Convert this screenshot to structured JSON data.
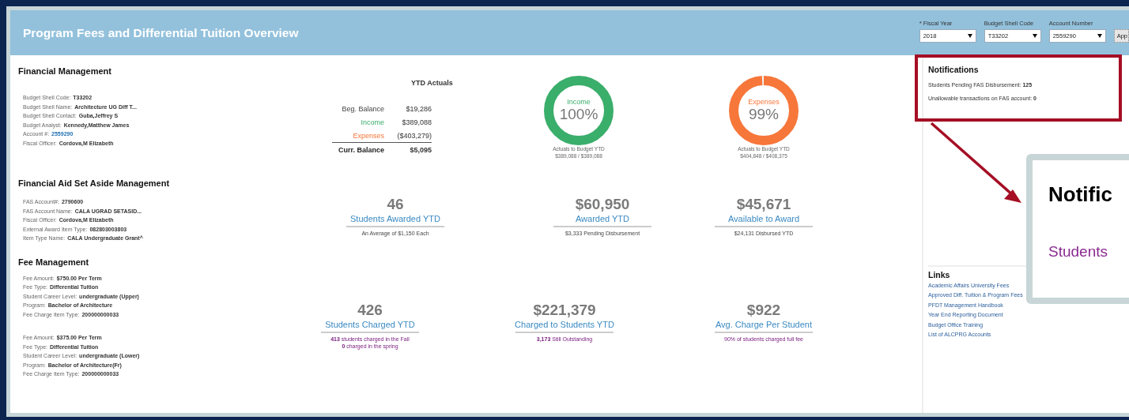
{
  "header": {
    "title": "Program Fees and Differential Tuition Overview",
    "filters": [
      {
        "label": "* Fiscal Year",
        "value": "2018"
      },
      {
        "label": "Budget Shell Code",
        "value": "T33202"
      },
      {
        "label": "Account Number",
        "value": "2559290"
      }
    ],
    "apply_button": "App"
  },
  "financial_management": {
    "title": "Financial Management",
    "details": [
      {
        "label": "Budget Shell Code:",
        "value": "T33202"
      },
      {
        "label": "Budget Shell Name:",
        "value": "Architecture UG Diff T..."
      },
      {
        "label": "Budget Shell Contact:",
        "value": "Guba,Jeffrey S"
      },
      {
        "label": "Budget Analyst:",
        "value": "Kennedy,Matthew James"
      },
      {
        "label": "Account #:",
        "value": "2559290",
        "kind": "link"
      },
      {
        "label": "Fiscal Officer:",
        "value": "Cordova,M Elizabeth"
      }
    ],
    "ytd_actuals": {
      "title": "YTD Actuals",
      "rows": [
        {
          "label": "Beg. Balance",
          "value": "$19,286",
          "kind": "plain"
        },
        {
          "label": "Income",
          "value": "$389,088",
          "kind": "income"
        },
        {
          "label": "Expenses",
          "value": "($403,279)",
          "kind": "expense"
        },
        {
          "label": "Curr. Balance",
          "value": "$5,095",
          "kind": "total"
        }
      ]
    },
    "donuts": [
      {
        "label": "Income",
        "percent": "100%",
        "level": 1,
        "color": "#3aae6b",
        "caption": [
          "Actuals to Budget YTD",
          "$389,088 / $389,088"
        ]
      },
      {
        "label": "Expenses",
        "percent": "99%",
        "level": 0.99,
        "color": "#f7773a",
        "caption": [
          "Actuals to Budget YTD",
          "$404,848 / $408,375"
        ]
      }
    ]
  },
  "fas_management": {
    "title": "Financial Aid Set Aside Management",
    "details": [
      {
        "label": "FAS Account#:",
        "value": "2790600"
      },
      {
        "label": "FAS Account Name:",
        "value": "CALA UGRAD SETASID..."
      },
      {
        "label": "Fiscal Officer:",
        "value": "Cordova,M Elizabeth"
      },
      {
        "label": "External Award Item Type:",
        "value": "082803003803"
      },
      {
        "label": "Item Type Name:",
        "value": "CALA Undergraduate Grant^"
      }
    ],
    "metrics": [
      {
        "value": "46",
        "label": "Students Awarded YTD",
        "caption": [
          "An Average of $1,150 Each"
        ]
      },
      {
        "value": "$60,950",
        "label": "Awarded YTD",
        "caption": [
          "$3,333 Pending Disbursement"
        ]
      },
      {
        "value": "$45,671",
        "label": "Available to Award",
        "caption": [
          "$24,131 Disbursed YTD"
        ]
      }
    ]
  },
  "fee_management": {
    "title": "Fee Management",
    "fee_groups": [
      [
        {
          "label": "Fee Amount:",
          "value": "$750.00 Per Term"
        },
        {
          "label": "Fee Type:",
          "value": "Differential Tuition"
        },
        {
          "label": "Student Career Level:",
          "value": "undergraduate (Upper)"
        },
        {
          "label": "Program:",
          "value": "Bachelor of Architecture"
        },
        {
          "label": "Fee Charge Item Type:",
          "value": "200000000033"
        }
      ],
      [
        {
          "label": "Fee Amount:",
          "value": "$375.00 Per Term"
        },
        {
          "label": "Fee Type:",
          "value": "Differential Tuition"
        },
        {
          "label": "Student Career Level:",
          "value": "undergraduate (Lower)"
        },
        {
          "label": "Program:",
          "value": "Bachelor of Architecture(Fr)"
        },
        {
          "label": "Fee Charge Item Type:",
          "value": "200000000033"
        }
      ]
    ],
    "metrics": [
      {
        "value": "426",
        "label": "Students Charged YTD",
        "caption": [
          "**413** students charged in the Fall",
          "**0** charged in the spring"
        ]
      },
      {
        "value": "$221,379",
        "label": "Charged to Students YTD",
        "caption": [
          "**3,173** Still Outstanding"
        ]
      },
      {
        "value": "$922",
        "label": "Avg. Charge Per Student",
        "caption": [
          "90% of students charged full fee"
        ]
      }
    ]
  },
  "notifications": {
    "title": "Notifications",
    "items": [
      "Students Pending FAS Disbursement: **125**",
      "Unallowable transactions on FAS account: **0**"
    ]
  },
  "links": {
    "title": "Links",
    "items": [
      "Academic Affairs University Fees",
      "Approved Diff. Tuition & Program Fees",
      "PFDT Management Handbook",
      "Year End Reporting Document",
      "Budget Office Training",
      "List of ALCPRG Accounts"
    ]
  },
  "callout": {
    "title": "Notific",
    "text": "Students"
  }
}
